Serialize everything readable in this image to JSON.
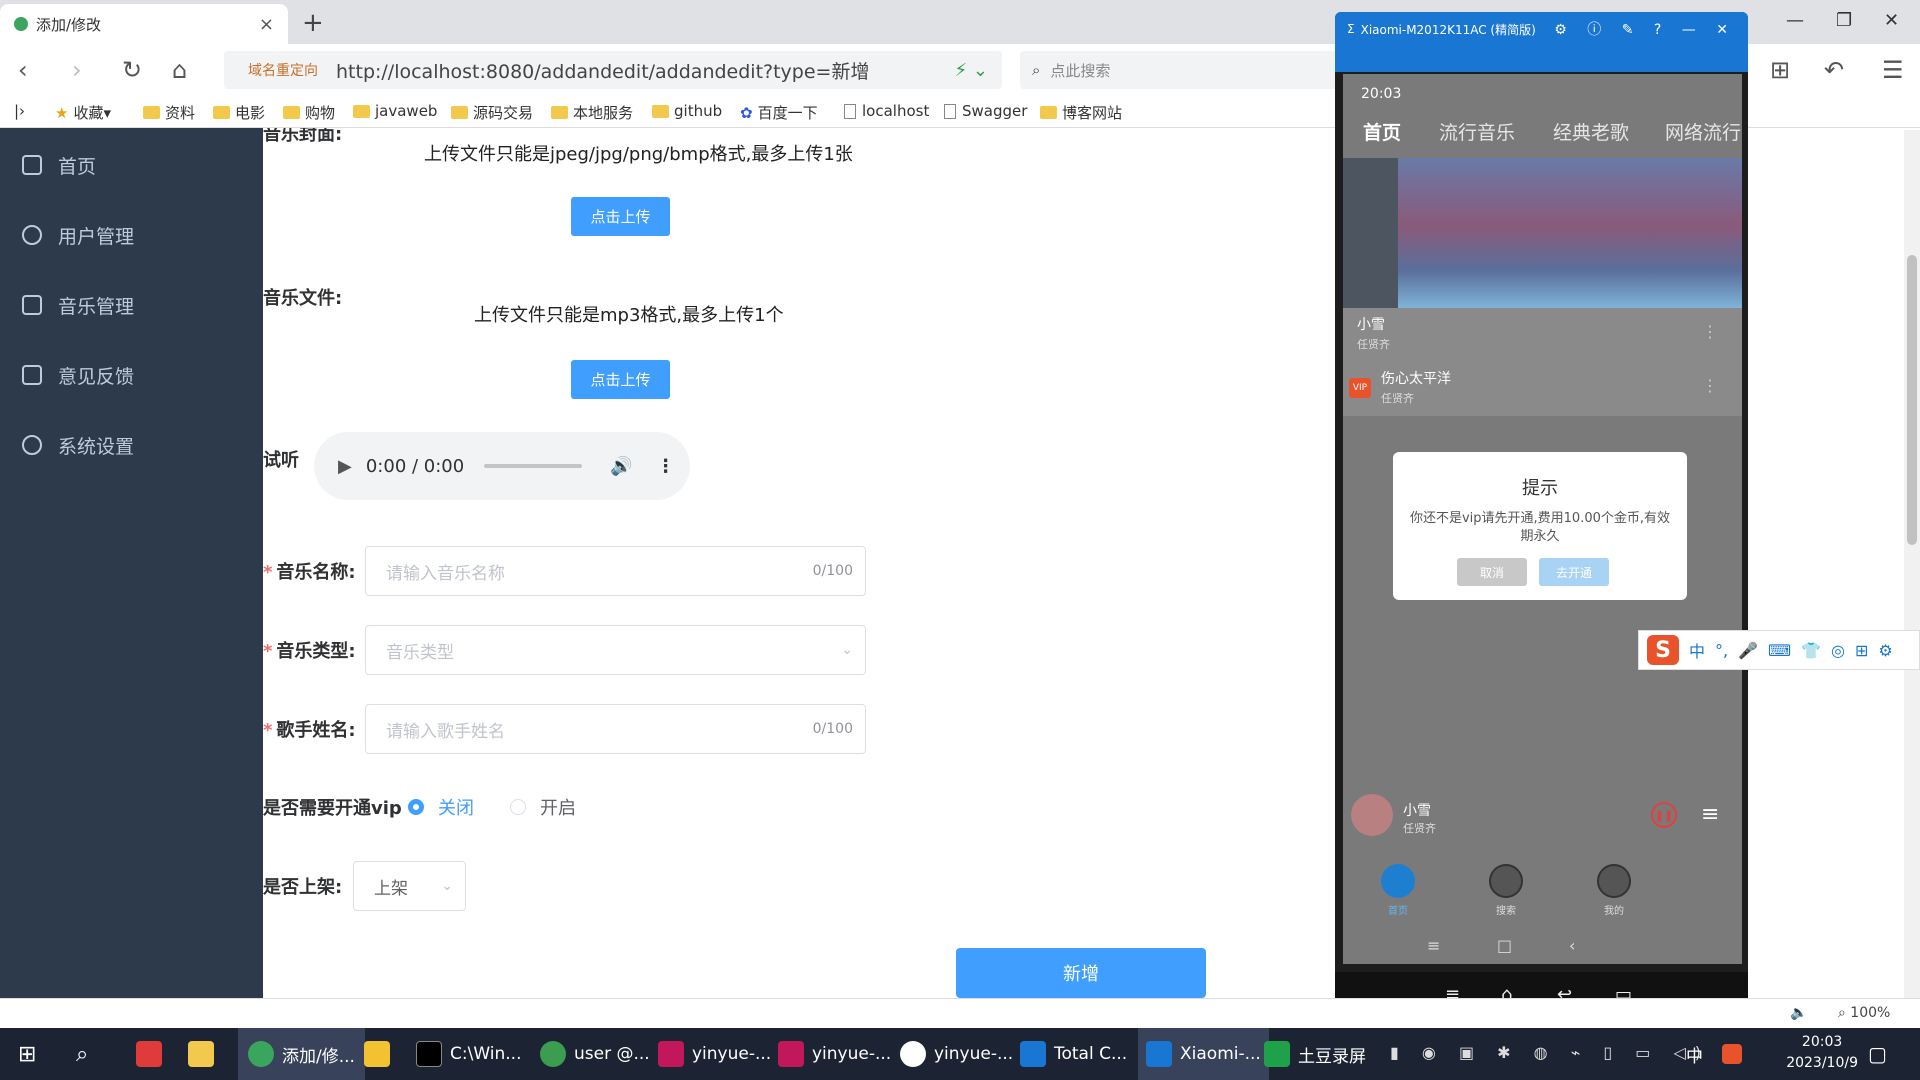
{
  "browser": {
    "tab_title": "添加/修改",
    "new_tab": "+",
    "redirect_label": "域名重定向",
    "url": "http://localhost:8080/addandedit/addandedit?type=新增",
    "search_placeholder": "点此搜索",
    "bookmarks": [
      "收藏",
      "资料",
      "电影",
      "购物",
      "javaweb",
      "源码交易",
      "本地服务",
      "github",
      "百度一下",
      "localhost",
      "Swagger",
      "博客网站"
    ],
    "zoom": "100%"
  },
  "sidebar": {
    "items": [
      {
        "label": "首页",
        "icon": "home-icon"
      },
      {
        "label": "用户管理",
        "icon": "user-icon"
      },
      {
        "label": "音乐管理",
        "icon": "music-icon"
      },
      {
        "label": "意见反馈",
        "icon": "feedback-icon"
      },
      {
        "label": "系统设置",
        "icon": "gear-icon"
      }
    ]
  },
  "form": {
    "cover_label": "音乐封面:",
    "cover_tip": "上传文件只能是jpeg/jpg/png/bmp格式,最多上传1张",
    "upload_button": "点击上传",
    "file_label": "音乐文件:",
    "file_tip": "上传文件只能是mp3格式,最多上传1个",
    "preview_label": "试听",
    "audio_time": "0:00 / 0:00",
    "name_label": "音乐名称:",
    "name_placeholder": "请输入音乐名称",
    "name_count": "0/100",
    "type_label": "音乐类型:",
    "type_placeholder": "音乐类型",
    "singer_label": "歌手姓名:",
    "singer_placeholder": "请输入歌手姓名",
    "singer_count": "0/100",
    "vip_label": "是否需要开通vip",
    "vip_off": "关闭",
    "vip_on": "开启",
    "shelf_label": "是否上架:",
    "shelf_value": "上架",
    "submit": "新增"
  },
  "phone": {
    "window_title": "Xiaomi-M2012K11AC (精简版)",
    "status_time": "20:03",
    "tabs": [
      "首页",
      "流行音乐",
      "经典老歌",
      "网络流行"
    ],
    "songs": [
      {
        "title": "小雪",
        "artist": "任贤齐",
        "vip": false
      },
      {
        "title": "伤心太平洋",
        "artist": "任贤齐",
        "vip": true
      }
    ],
    "vip_badge": "VIP",
    "dialog": {
      "title": "提示",
      "body": "你还不是vip请先开通,费用10.00个金币,有效期永久",
      "cancel": "取消",
      "confirm": "去开通"
    },
    "player": {
      "title": "小雪",
      "artist": "任贤齐"
    },
    "bottom_nav": [
      "首页",
      "搜索",
      "我的"
    ]
  },
  "ime": {
    "mode": "中"
  },
  "taskbar": {
    "items": [
      "添加/修...",
      "C:\\Win...",
      "user @...",
      "yinyue-...",
      "yinyue-...",
      "yinyue-...",
      "Total C...",
      "Xiaomi-...",
      "土豆录屏"
    ],
    "clock_time": "20:03",
    "clock_date": "2023/10/9",
    "ime_mode": "中"
  },
  "colors": {
    "primary": "#409eff",
    "sidebar_bg": "#2d3a4b",
    "required": "#f56c6c"
  }
}
